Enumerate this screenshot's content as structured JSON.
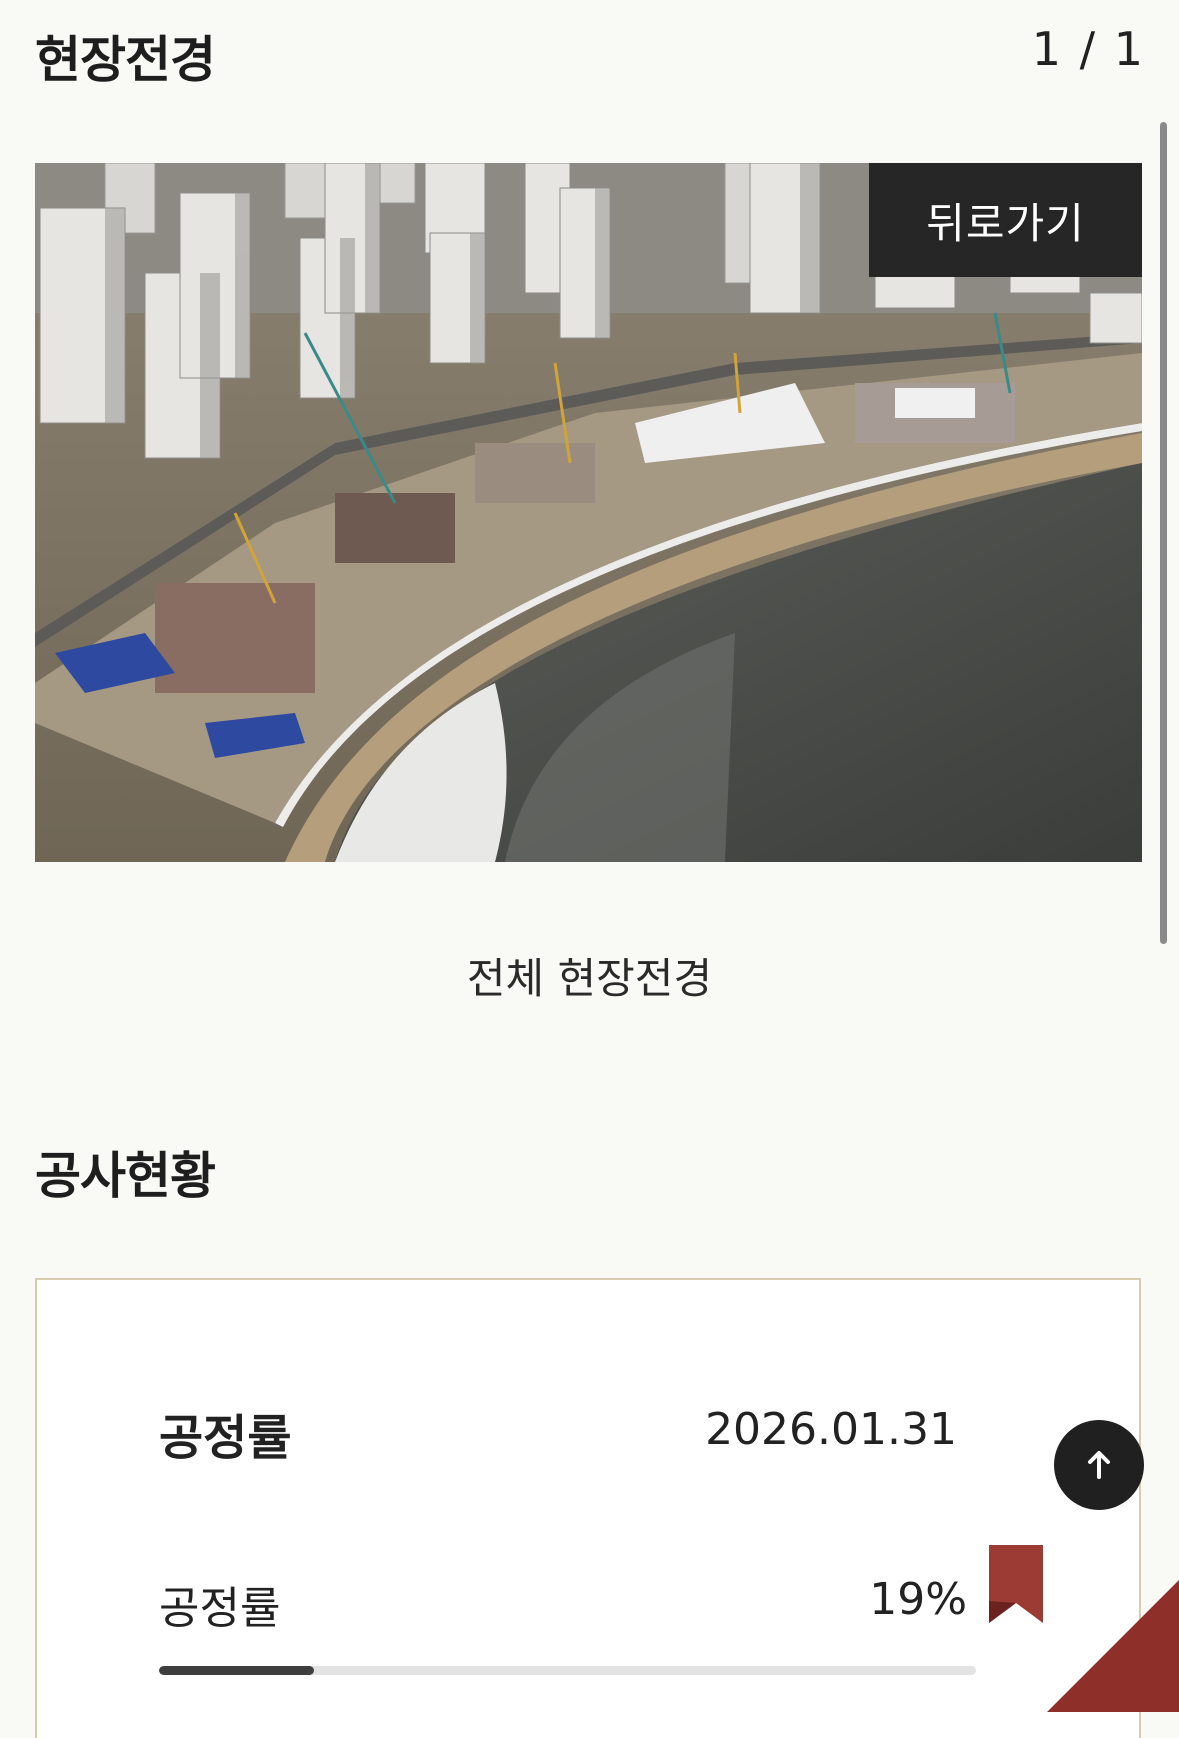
{
  "gallery": {
    "title": "현장전경",
    "counter": "1 / 1",
    "back_label": "뒤로가기",
    "caption": "전체 현장전경"
  },
  "status": {
    "title": "공사현황",
    "card": {
      "title": "공정률",
      "date": "2026.01.31",
      "rate_label": "공정률",
      "rate_value": "19%",
      "progress_fraction": 0.19
    }
  },
  "icons": {
    "scroll_top": "arrow-up-icon",
    "bookmark": "bookmark-icon"
  },
  "colors": {
    "background": "#f9f9f6",
    "dark": "#262626",
    "card_border": "#d8ccae",
    "accent": "#8f2f2a",
    "progress_fill": "#3e3e3e",
    "progress_track": "#e3e3e3"
  }
}
